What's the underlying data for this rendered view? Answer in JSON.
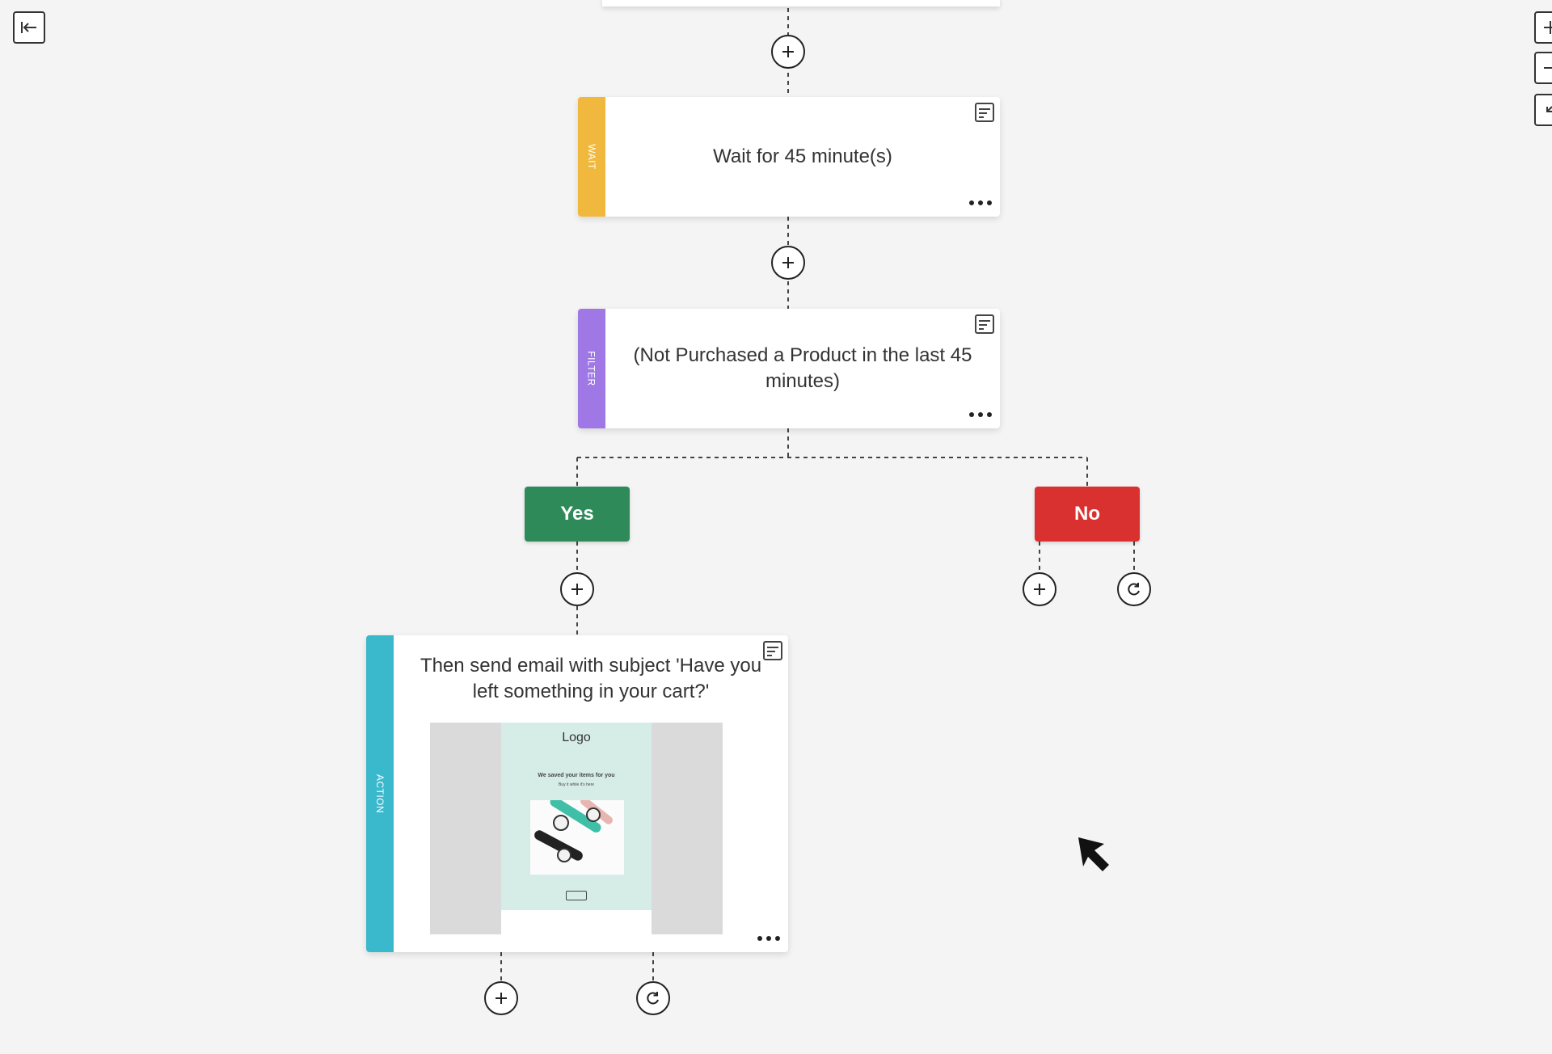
{
  "toolbar": {
    "collapse_icon": "collapse-left-icon",
    "zoom_in_icon": "plus-icon",
    "zoom_out_icon": "minus-icon",
    "fit_icon": "fit-screen-icon"
  },
  "nodes": {
    "wait": {
      "type_label": "WAIT",
      "text": "Wait for 45 minute(s)",
      "color": "#f0b93e"
    },
    "filter": {
      "type_label": "FILTER",
      "text_line1": "(Not Purchased a Product in the last 45",
      "text_line2": "minutes)",
      "color": "#a078e6"
    },
    "action": {
      "type_label": "ACTION",
      "text_line1": "Then send email with subject 'Have you",
      "text_line2": "left something in your cart?'",
      "color": "#3ab8cc",
      "preview": {
        "logo": "Logo",
        "heading": "We saved your items for you",
        "subheading": "Buy it while it's here"
      }
    }
  },
  "branches": {
    "yes": {
      "label": "Yes",
      "color": "#2f8a5a"
    },
    "no": {
      "label": "No",
      "color": "#d9312f"
    }
  },
  "icons": {
    "add": "plus-circle-icon",
    "loop": "loop-icon",
    "note": "note-icon",
    "more": "more-dots-icon",
    "cursor": "mouse-cursor-icon"
  }
}
